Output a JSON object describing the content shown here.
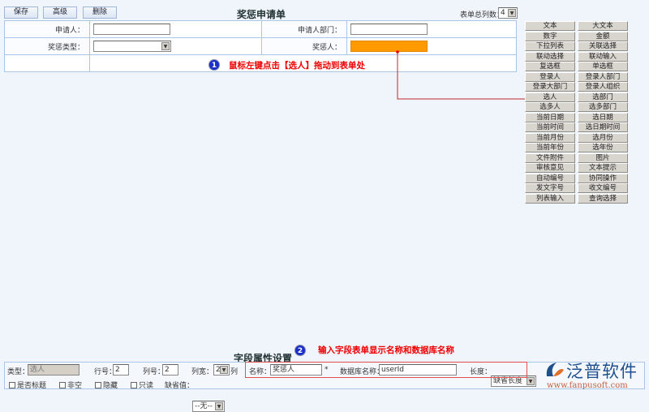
{
  "toolbar": {
    "save": "保存",
    "advanced": "高级",
    "delete": "删除"
  },
  "form": {
    "title": "奖惩申请单",
    "columns_label": "表单总列数：",
    "columns_value": "4",
    "fields": [
      {
        "label": "申请人：",
        "value": ""
      },
      {
        "label": "申请人部门：",
        "value": ""
      },
      {
        "label": "奖惩类型：",
        "value": ""
      },
      {
        "label": "奖惩人：",
        "value": ""
      }
    ]
  },
  "palette": [
    [
      "文本",
      "大文本"
    ],
    [
      "数字",
      "金额"
    ],
    [
      "下拉列表",
      "关联选择"
    ],
    [
      "联动选择",
      "联动输入"
    ],
    [
      "复选框",
      "单选框"
    ],
    [
      "登录人",
      "登录人部门"
    ],
    [
      "登录大部门",
      "登录人组织"
    ],
    [
      "选人",
      "选部门"
    ],
    [
      "选多人",
      "选多部门"
    ],
    [
      "当前日期",
      "选日期"
    ],
    [
      "当前时间",
      "选日期时间"
    ],
    [
      "当前月份",
      "选月份"
    ],
    [
      "当前年份",
      "选年份"
    ],
    [
      "文件附件",
      "图片"
    ],
    [
      "审核意见",
      "文本提示"
    ],
    [
      "自动编号",
      "协同操作"
    ],
    [
      "发文字号",
      "收文编号"
    ],
    [
      "列表输入",
      "查询选择"
    ]
  ],
  "annotations": {
    "step1_num": "1",
    "step1": "鼠标左键点击【选人】拖动到表单处",
    "step2_num": "2",
    "step2": "输入字段表单显示名称和数据库名称"
  },
  "props": {
    "title": "字段属性设置",
    "type_label": "类型：",
    "type_value": "选人",
    "row_label": "行号：",
    "row_value": "2",
    "col_label": "列号：",
    "col_value": "2",
    "width_label": "列宽：",
    "width_value": "2",
    "width_unit": "列",
    "name_label": "名称：",
    "name_value": "奖惩人",
    "required_mark": "*",
    "db_label": "数据库名称：",
    "db_value": "userId",
    "length_label": "长度：",
    "length_value": "缺省长度",
    "is_title": "是否标题",
    "not_null": "非空",
    "hidden": "隐藏",
    "readonly": "只读",
    "default_label": "缺省值：",
    "default_value": "--无--"
  },
  "logo": {
    "name": "泛普软件",
    "url": "www.fanpusoft.com"
  },
  "colors": {
    "accent": "#ff9900",
    "annotation": "#e00000"
  }
}
